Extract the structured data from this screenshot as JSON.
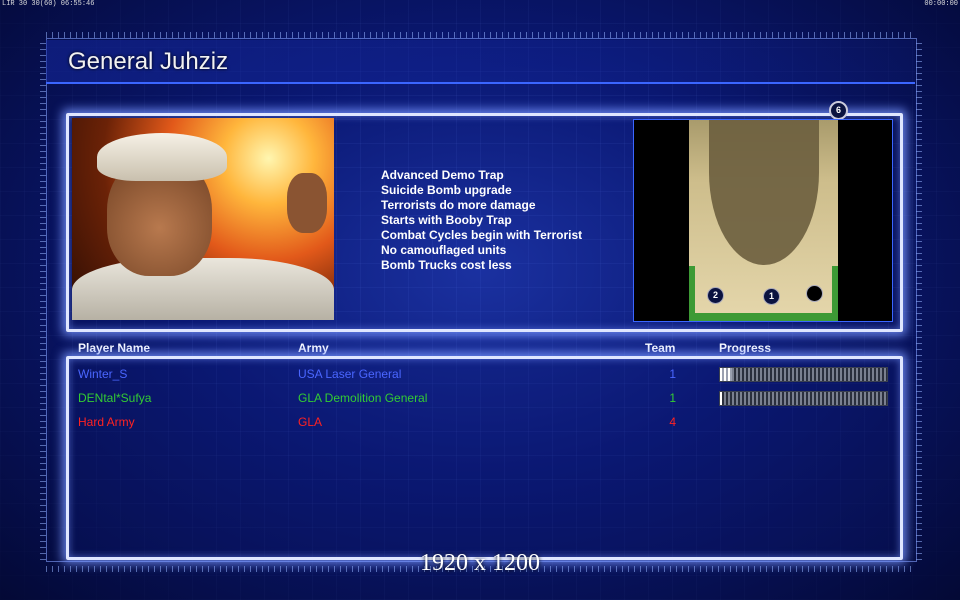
{
  "status_bar": {
    "left": "LIR 30 30(60) 06:55:46",
    "right": "00:00:00"
  },
  "general_name": "General Juhziz",
  "features": [
    "Advanced Demo Trap",
    "Suicide Bomb upgrade",
    "Terrorists do more damage",
    "Starts with Booby Trap",
    "Combat Cycles begin with Terrorist",
    "No camouflaged units",
    "Bomb Trucks cost less"
  ],
  "map": {
    "player_count_badge": "6",
    "start_positions": [
      "2",
      "1",
      ""
    ]
  },
  "table": {
    "headers": {
      "name": "Player Name",
      "army": "Army",
      "team": "Team",
      "progress": "Progress"
    },
    "players": [
      {
        "name": "Winter_S",
        "army": "USA Laser General",
        "team": "1",
        "color": "#4a66ff",
        "progress": 0.07,
        "has_progress": true
      },
      {
        "name": "DENtal*Sufya",
        "army": "GLA Demolition General",
        "team": "1",
        "color": "#33cc33",
        "progress": 0.01,
        "has_progress": true
      },
      {
        "name": "Hard Army",
        "army": "GLA",
        "team": "4",
        "color": "#ff2222",
        "progress": 0,
        "has_progress": false
      }
    ]
  },
  "resolution_label": "1920 x 1200",
  "colors": {
    "accent": "#3b66ff",
    "panel_border": "#dfe6ff",
    "background": "#0a1770"
  }
}
